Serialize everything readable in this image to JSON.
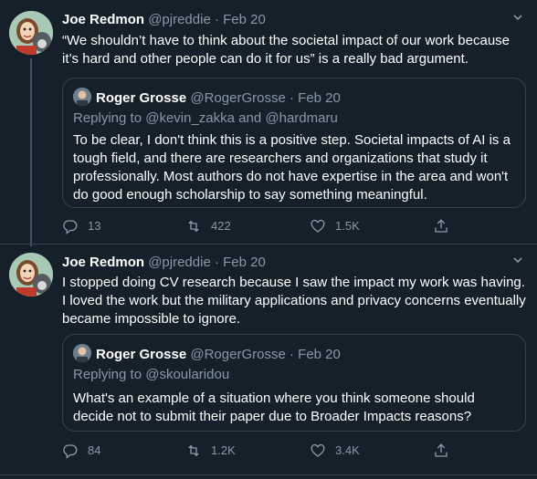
{
  "tweet1": {
    "name": "Joe Redmon",
    "handle": "@pjreddie",
    "dot": "·",
    "date": "Feb 20",
    "text": "“We shouldn’t have to think about the societal impact of our work because it’s hard and other people can do it for us” is a really bad argument.",
    "quote": {
      "name": "Roger Grosse",
      "handle": "@RogerGrosse",
      "dot": "·",
      "date": "Feb 20",
      "reply_prefix": "Replying to ",
      "reply_user1": "@kevin_zakka",
      "reply_and": " and ",
      "reply_user2": "@hardmaru",
      "text": "To be clear, I don't think this is a positive step. Societal impacts of AI is a tough field, and there are researchers and organizations that study it professionally. Most authors do not have expertise in the area and won't do good enough scholarship to say something meaningful."
    },
    "actions": {
      "replies": "13",
      "retweets": "422",
      "likes": "1.5K"
    }
  },
  "tweet2": {
    "name": "Joe Redmon",
    "handle": "@pjreddie",
    "dot": "·",
    "date": "Feb 20",
    "text": "I stopped doing CV research because I saw the impact my work was having. I loved the work but the military applications and privacy concerns eventually became impossible to ignore.",
    "quote": {
      "name": "Roger Grosse",
      "handle": "@RogerGrosse",
      "dot": "·",
      "date": "Feb 20",
      "reply_prefix": "Replying to ",
      "reply_user1": "@skoularidou",
      "text": "What's an example of a situation where you think someone should decide not to submit their paper due to Broader Impacts reasons?"
    },
    "actions": {
      "replies": "84",
      "retweets": "1.2K",
      "likes": "3.4K"
    }
  },
  "icons": {
    "reply": "reply-icon",
    "retweet": "retweet-icon",
    "like": "like-icon",
    "share": "share-icon",
    "caret": "chevron-down-icon"
  },
  "colors": {
    "background": "#15202b",
    "secondary_text": "#8899a6",
    "border": "#38444d"
  }
}
